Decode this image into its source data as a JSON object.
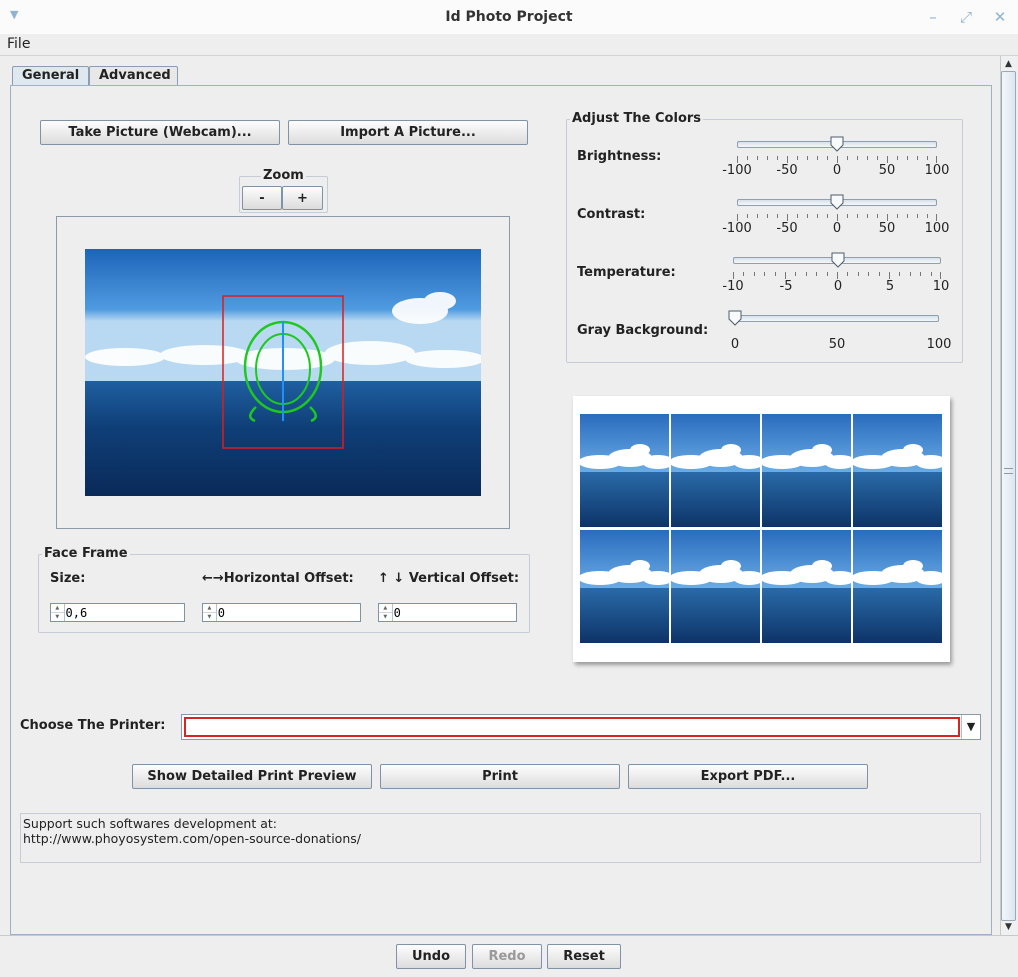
{
  "window": {
    "title": "Id Photo Project"
  },
  "menu": {
    "items": [
      "File"
    ]
  },
  "tabs": [
    {
      "label": "General",
      "active": true
    },
    {
      "label": "Advanced",
      "active": false
    }
  ],
  "photo": {
    "take_picture_label": "Take Picture (Webcam)...",
    "import_label": "Import A Picture..."
  },
  "zoom": {
    "title": "Zoom",
    "minus_label": "-",
    "plus_label": "+"
  },
  "face_frame": {
    "title": "Face Frame",
    "size_label": "Size:",
    "size_value": "0,6",
    "horizontal_label": "←→Horizontal Offset:",
    "horizontal_value": "0",
    "vertical_label": "↑ ↓ Vertical Offset:",
    "vertical_value": "0"
  },
  "colors": {
    "title": "Adjust The Colors",
    "sliders": [
      {
        "label": "Brightness:",
        "value": 0,
        "ticks": [
          "-100",
          "-50",
          "0",
          "50",
          "100"
        ]
      },
      {
        "label": "Contrast:",
        "value": 0,
        "ticks": [
          "-100",
          "-50",
          "0",
          "50",
          "100"
        ]
      },
      {
        "label": "Temperature:",
        "value": 0,
        "ticks": [
          "-10",
          "-5",
          "0",
          "5",
          "10"
        ]
      },
      {
        "label": "Gray Background:",
        "value": 0,
        "ticks": [
          "0",
          "50",
          "100"
        ]
      }
    ]
  },
  "printer": {
    "label": "Choose The Printer:",
    "value": ""
  },
  "actions": {
    "preview_label": "Show Detailed Print Preview",
    "print_label": "Print",
    "export_label": "Export PDF..."
  },
  "support_text": "Support such softwares development at:\nhttp://www.phoyosystem.com/open-source-donations/",
  "bottom": {
    "undo_label": "Undo",
    "redo_label": "Redo",
    "reset_label": "Reset"
  },
  "accent": {
    "face_frame_color": "#e01b1b",
    "face_guide_color": "#1ec81e",
    "center_line_color": "#1e90ff"
  }
}
